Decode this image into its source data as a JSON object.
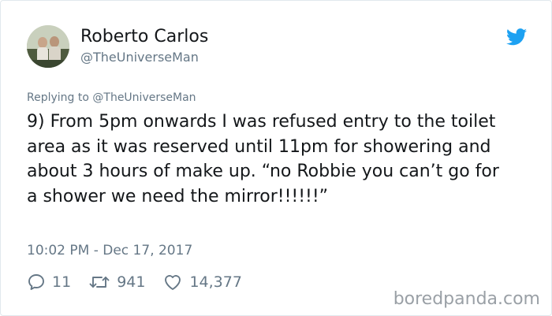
{
  "author": {
    "name": "Roberto Carlos",
    "handle": "@TheUniverseMan",
    "avatar_icon": "avatar-photo"
  },
  "platform_icon": "twitter-bird-icon",
  "colors": {
    "brand": "#1da1f2",
    "text": "#14171a",
    "muted": "#657786",
    "watermark": "#9aa0a6"
  },
  "reply": {
    "prefix": "Replying to",
    "mention": "@TheUniverseMan"
  },
  "tweet": {
    "text": "9) From 5pm onwards I was refused entry to the toilet area as it was reserved until 11pm for showering and about 3 hours of make up. “no Robbie you can’t go for a shower we need the mirror!!!!!!”",
    "timestamp": "10:02 PM - Dec 17, 2017"
  },
  "actions": {
    "replies": "11",
    "retweets": "941",
    "likes": "14,377"
  },
  "watermark": "boredpanda.com"
}
